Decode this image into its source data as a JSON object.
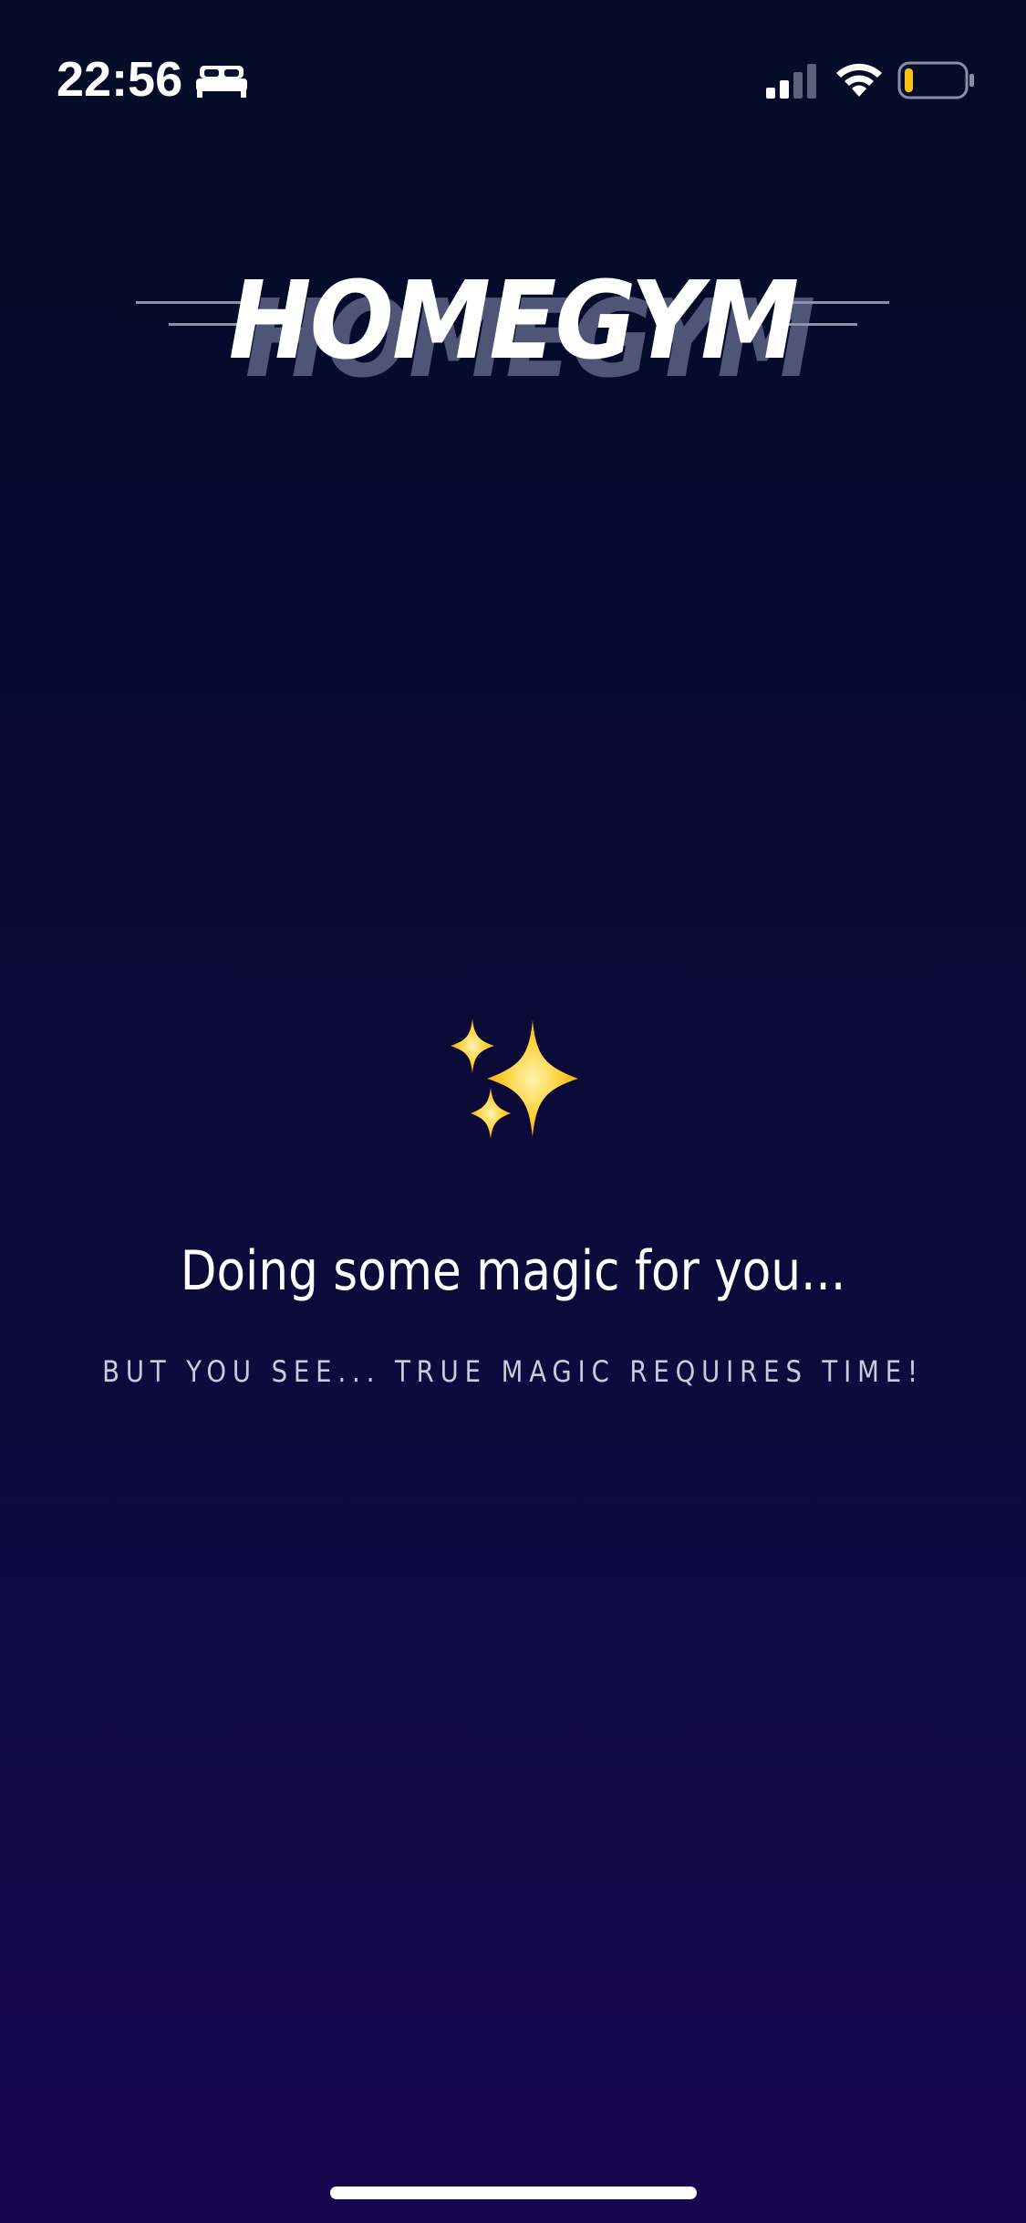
{
  "status_bar": {
    "time": "22:56",
    "icons": [
      "bed-icon",
      "cellular-signal-icon",
      "wifi-icon",
      "battery-icon"
    ],
    "battery_level": 0.15,
    "battery_color": "#f6c20f"
  },
  "logo": {
    "text": "HOMEGYM"
  },
  "loading": {
    "icon": "sparkles-icon",
    "title": "Doing some magic for you...",
    "subtitle": "BUT YOU SEE... TRUE MAGIC REQUIRES TIME!"
  },
  "colors": {
    "background_top": "#030c27",
    "background_bottom": "#160750",
    "text_primary": "#ffffff",
    "text_secondary": "#c9cbdc",
    "sparkle": "#ffd23a"
  }
}
